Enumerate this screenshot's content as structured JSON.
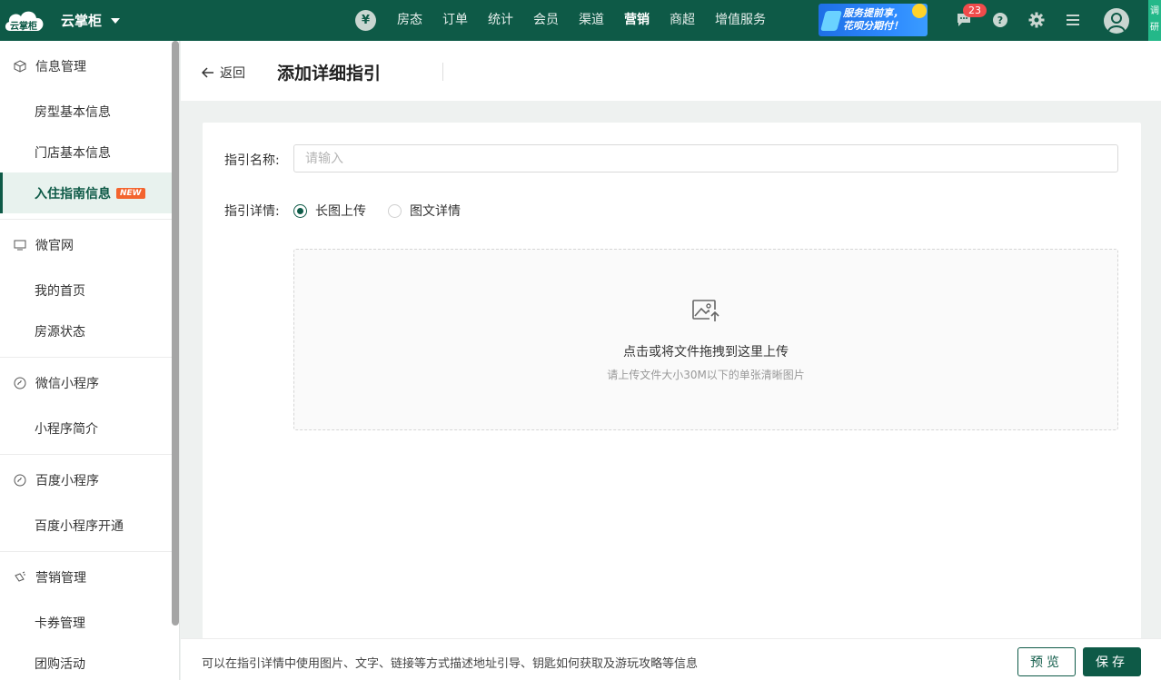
{
  "topbar": {
    "logo_text": "云掌柜",
    "brand": "云掌柜",
    "currency_icon": "¥",
    "nav": [
      "房态",
      "订单",
      "统计",
      "会员",
      "渠道",
      "营销",
      "商超",
      "增值服务"
    ],
    "active_nav": "营销",
    "promo_line1": "服务提前享，",
    "promo_line2": "花呗分期付！",
    "message_count": "23",
    "survey_text": "调研"
  },
  "sidebar": {
    "groups": [
      {
        "title": "信息管理",
        "icon": "cube-icon",
        "items": [
          "房型基本信息",
          "门店基本信息",
          "入住指南信息"
        ]
      },
      {
        "title": "微官网",
        "icon": "monitor-icon",
        "items": [
          "我的首页",
          "房源状态"
        ]
      },
      {
        "title": "微信小程序",
        "icon": "miniprogram-icon",
        "items": [
          "小程序简介"
        ]
      },
      {
        "title": "百度小程序",
        "icon": "miniprogram-icon",
        "items": [
          "百度小程序开通"
        ]
      },
      {
        "title": "营销管理",
        "icon": "megaphone-icon",
        "items": [
          "卡券管理",
          "团购活动"
        ]
      }
    ],
    "active_item": "入住指南信息",
    "new_tag": "NEW"
  },
  "header": {
    "back_label": "返回",
    "title": "添加详细指引"
  },
  "form": {
    "name_label": "指引名称:",
    "name_placeholder": "请输入",
    "name_value": "",
    "detail_label": "指引详情:",
    "option_long_image": "长图上传",
    "option_rich_text": "图文详情",
    "selected_option": "长图上传",
    "upload_title": "点击或将文件拖拽到这里上传",
    "upload_hint": "请上传文件大小30M以下的单张清晰图片"
  },
  "footer": {
    "tip": "可以在指引详情中使用图片、文字、链接等方式描述地址引导、钥匙如何获取及游玩攻略等信息",
    "preview_label": "预览",
    "save_label": "保存"
  },
  "colors": {
    "brand_green": "#0e5a47",
    "active_bg": "#e8f2ee",
    "badge_red": "#f04b4b",
    "new_tag": "#f3642e"
  }
}
